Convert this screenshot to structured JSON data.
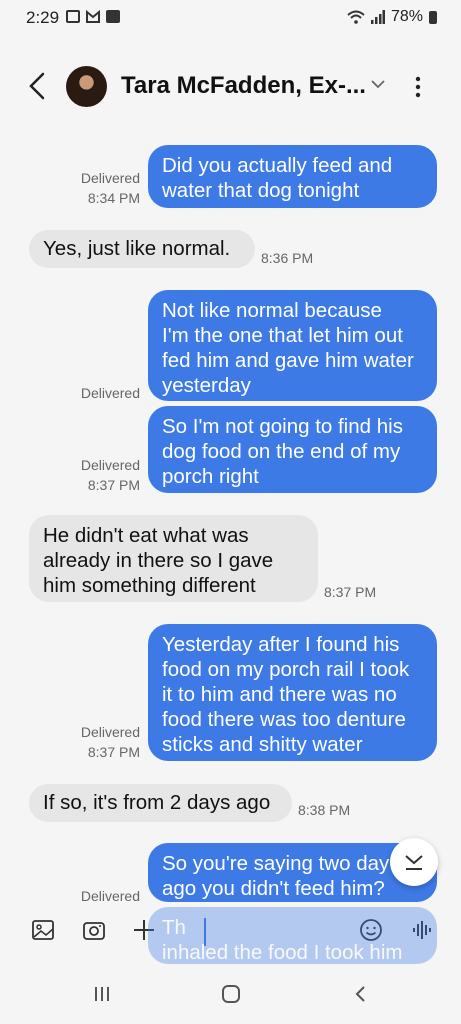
{
  "status_bar": {
    "time": "2:29",
    "battery": "78%"
  },
  "header": {
    "contact_name": "Tara McFadden, Ex-..."
  },
  "messages": [
    {
      "type": "sent",
      "lines": [
        "Did you actually feed and",
        "water that dog tonight"
      ],
      "status": "Delivered",
      "time": "8:34 PM"
    },
    {
      "type": "received",
      "lines": [
        "Yes, just like normal."
      ],
      "time": "8:36 PM"
    },
    {
      "type": "sent",
      "lines": [
        "Not like normal because",
        "I'm the one that let him out",
        "fed him and gave him water",
        "yesterday"
      ],
      "status": "Delivered"
    },
    {
      "type": "sent",
      "lines": [
        "So I'm not going to find his",
        "dog food on the end of my",
        "porch right"
      ],
      "status": "Delivered",
      "time": "8:37 PM"
    },
    {
      "type": "received",
      "lines": [
        "He didn't eat what was",
        "already in there so I gave",
        "him something different"
      ],
      "time": "8:37 PM"
    },
    {
      "type": "sent",
      "lines": [
        "Yesterday after I found his",
        "food on my porch rail I took",
        "it to him and there was no",
        "food there was too denture",
        "sticks and shitty water"
      ],
      "status": "Delivered",
      "time": "8:37 PM"
    },
    {
      "type": "received",
      "lines": [
        "If so, it's from 2 days ago"
      ],
      "time": "8:38 PM"
    },
    {
      "type": "sent",
      "lines": [
        "So you're saying two day",
        "ago you didn't feed him?"
      ],
      "status": "Delivered"
    },
    {
      "type": "sent",
      "lines": [
        "Th",
        "inhaled the food I took him"
      ]
    }
  ],
  "icons": {
    "scroll_down": "chevron-down-icon",
    "gallery": "image-icon",
    "camera": "camera-icon",
    "add": "plus-icon",
    "emoji": "emoji-icon",
    "voice": "voice-wave-icon"
  },
  "colors": {
    "sent_bubble": "#3d7ae6",
    "received_bubble": "#e6e6e6"
  }
}
